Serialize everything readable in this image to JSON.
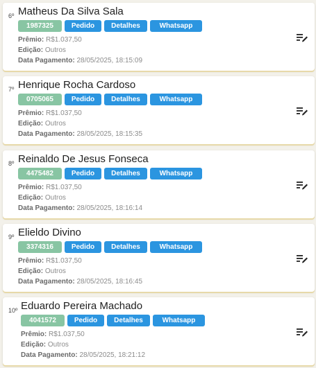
{
  "labels": {
    "premio": "Prêmio:",
    "edicao": "Edição:",
    "data_pagamento": "Data Pagamento:",
    "pedido": "Pedido",
    "detalhes": "Detalhes",
    "whatsapp": "Whatsapp"
  },
  "colors": {
    "code_badge": "#88c5a3",
    "action_button": "#2b95e0",
    "card_shadow": "#e7d9a9"
  },
  "icons": {
    "row_action": "edit-list-icon"
  },
  "items": [
    {
      "rank": "6º",
      "name": "Matheus Da Silva Sala",
      "code": "1987325",
      "premio": "R$1.037,50",
      "edicao": "Outros",
      "data_pagamento": "28/05/2025, 18:15:09"
    },
    {
      "rank": "7º",
      "name": "Henrique Rocha Cardoso",
      "code": "0705065",
      "premio": "R$1.037,50",
      "edicao": "Outros",
      "data_pagamento": "28/05/2025, 18:15:35"
    },
    {
      "rank": "8º",
      "name": "Reinaldo De Jesus Fonseca",
      "code": "4475482",
      "premio": "R$1.037,50",
      "edicao": "Outros",
      "data_pagamento": "28/05/2025, 18:16:14"
    },
    {
      "rank": "9º",
      "name": "Elieldo Divino",
      "code": "3374316",
      "premio": "R$1.037,50",
      "edicao": "Outros",
      "data_pagamento": "28/05/2025, 18:16:45"
    },
    {
      "rank": "10º",
      "name": "Eduardo Pereira Machado",
      "code": "4041572",
      "premio": "R$1.037,50",
      "edicao": "Outros",
      "data_pagamento": "28/05/2025, 18:21:12"
    }
  ]
}
